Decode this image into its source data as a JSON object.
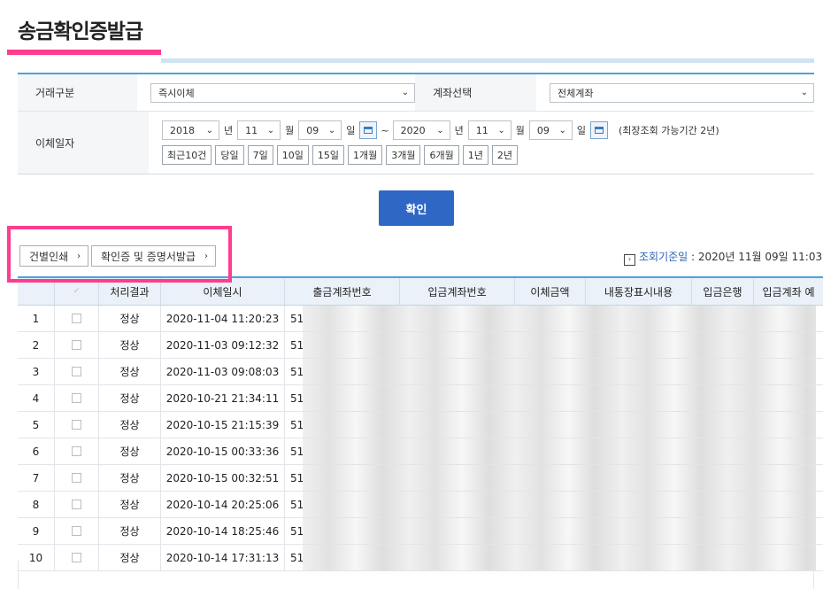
{
  "page": {
    "title": "송금확인증발급"
  },
  "form": {
    "trade_label": "거래구분",
    "trade_value": "즉시이체",
    "account_label": "계좌선택",
    "account_value": "전체계좌",
    "date_label": "이체일자",
    "start_year": "2018",
    "start_month": "11",
    "start_day": "09",
    "end_year": "2020",
    "end_month": "11",
    "end_day": "09",
    "unit_year": "년",
    "unit_month": "월",
    "unit_day": "일",
    "tilde": "~",
    "max_period_note": "(최장조회 가능기간 2년)",
    "quick_ranges": [
      "최근10건",
      "당일",
      "7일",
      "10일",
      "15일",
      "1개월",
      "3개월",
      "6개월",
      "1년",
      "2년"
    ]
  },
  "confirm_label": "확인",
  "actions": {
    "print_each": "건별인쇄",
    "issue_cert": "확인증 및 증명서발급"
  },
  "ref_date": {
    "label": "조회기준일",
    "value": " : 2020년 11월 09일 11:03"
  },
  "table": {
    "headers": [
      "",
      "",
      "처리결과",
      "이체일시",
      "출금계좌번호",
      "입금계좌번호",
      "이체금액",
      "내통장표시내용",
      "입금은행",
      "입금계좌 예"
    ],
    "rows": [
      {
        "no": "1",
        "status": "정상",
        "datetime": "2020-11-04 11:20:23",
        "account": "51"
      },
      {
        "no": "2",
        "status": "정상",
        "datetime": "2020-11-03 09:12:32",
        "account": "51"
      },
      {
        "no": "3",
        "status": "정상",
        "datetime": "2020-11-03 09:08:03",
        "account": "51"
      },
      {
        "no": "4",
        "status": "정상",
        "datetime": "2020-10-21 21:34:11",
        "account": "51"
      },
      {
        "no": "5",
        "status": "정상",
        "datetime": "2020-10-15 21:15:39",
        "account": "51"
      },
      {
        "no": "6",
        "status": "정상",
        "datetime": "2020-10-15 00:33:36",
        "account": "51"
      },
      {
        "no": "7",
        "status": "정상",
        "datetime": "2020-10-15 00:32:51",
        "account": "51"
      },
      {
        "no": "8",
        "status": "정상",
        "datetime": "2020-10-14 20:25:06",
        "account": "51"
      },
      {
        "no": "9",
        "status": "정상",
        "datetime": "2020-10-14 18:25:46",
        "account": "51"
      },
      {
        "no": "10",
        "status": "정상",
        "datetime": "2020-10-14 17:31:13",
        "account": "51"
      }
    ]
  },
  "colors": {
    "accent_blue": "#4aa3df",
    "confirm_button": "#2f67c4",
    "highlight_pink": "#ff3c8e"
  }
}
